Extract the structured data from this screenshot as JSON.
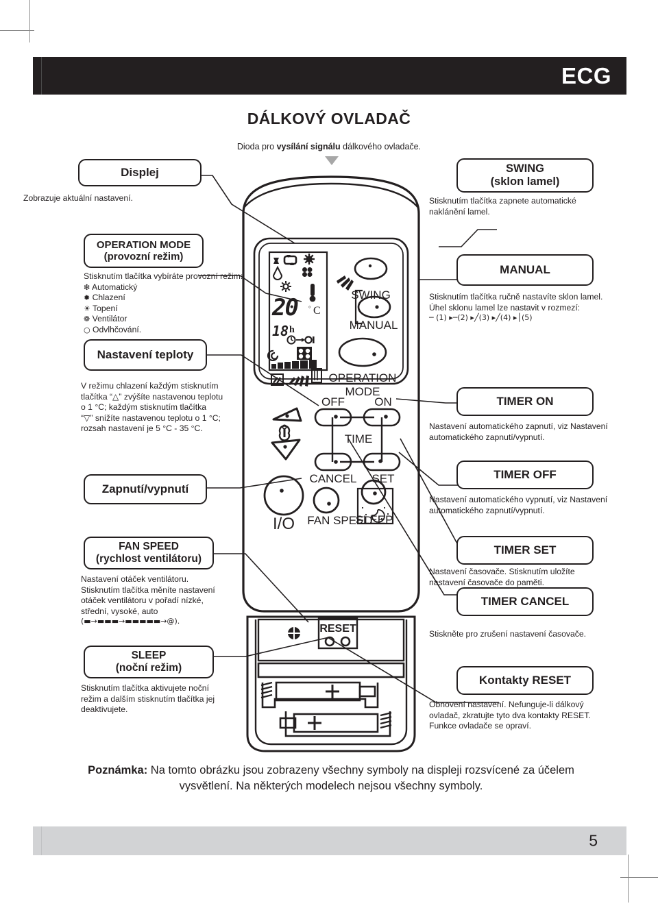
{
  "header": {
    "brand": "ECG"
  },
  "document": {
    "title": "DÁLKOVÝ OVLADAČ",
    "led_caption_pre": "Dioda pro ",
    "led_caption_bold": "vysílání signálu",
    "led_caption_post": " dálkového ovladače."
  },
  "callouts": {
    "display": {
      "title": "Displej",
      "desc": "Zobrazuje aktuální nastavení."
    },
    "operation_mode": {
      "title_line1": "OPERATION MODE",
      "title_line2": "(provozní režim)",
      "desc_intro": "Stisknutím tlačítka vybíráte provozní režim:",
      "modes": [
        {
          "icon": "auto-mode-icon",
          "glyph": "❇",
          "label": "Automatický"
        },
        {
          "icon": "cooling-icon",
          "glyph": "✹",
          "label": "Chlazení"
        },
        {
          "icon": "heating-icon",
          "glyph": "☀",
          "label": "Topení"
        },
        {
          "icon": "fan-icon",
          "glyph": "❁",
          "label": "Ventilátor"
        },
        {
          "icon": "dehumidify-icon",
          "glyph": "○",
          "label": "Odvlhčování."
        }
      ]
    },
    "temperature": {
      "title": "Nastavení teploty",
      "desc_lines": [
        "V režimu chlazení každým stisknutím",
        "tlačítka “△” zvýšíte nastavenou teplotu",
        "o 1 °C; každým stisknutím tlačítka",
        "“▽” snížíte nastavenou teplotu o 1 °C;",
        "rozsah nastavení je 5 °C - 35 °C."
      ]
    },
    "power": {
      "title": "Zapnutí/vypnutí"
    },
    "fan_speed": {
      "title_line1": "FAN SPEED",
      "title_line2": "(rychlost ventilátoru)",
      "desc_lines": [
        "Nastavení otáček ventilátoru.",
        "Stisknutím tlačítka měníte nastavení",
        "otáček ventilátoru v pořadí nízké,",
        "střední, vysoké, auto"
      ],
      "desc_symbols": "(▬→▬▬▬→▬▬▬▬▬→@)."
    },
    "sleep": {
      "title_line1": "SLEEP",
      "title_line2": "(noční režim)",
      "desc_lines": [
        "Stisknutím tlačítka aktivujete noční",
        "režim a dalším stisknutím tlačítka jej",
        "deaktivujete."
      ]
    },
    "swing": {
      "title_line1": "SWING",
      "title_line2": "(sklon lamel)",
      "desc_lines": [
        "Stisknutím tlačítka zapnete automatické",
        "naklánění lamel."
      ]
    },
    "manual": {
      "title": "MANUAL",
      "desc_lines": [
        "Stisknutím tlačítka ručně nastavíte sklon lamel.",
        "Úhel sklonu lamel lze nastavit v rozmezí:"
      ],
      "angle_line": "─ (1)   ▸─(2)   ▸╱(3)   ▸╱(4)   ▸│(5)"
    },
    "timer_on": {
      "title": "TIMER ON",
      "desc_lines": [
        "Nastavení automatického zapnutí, viz Nastavení",
        "automatického zapnutí/vypnutí."
      ]
    },
    "timer_off": {
      "title": "TIMER OFF",
      "desc_lines": [
        "Nastavení automatického vypnutí, viz Nastavení",
        "automatického zapnutí/vypnutí."
      ]
    },
    "timer_set": {
      "title": "TIMER SET",
      "desc_lines": [
        "Nastavení časovače. Stisknutím uložíte",
        "nastavení časovače do paměti."
      ]
    },
    "timer_cancel": {
      "title": "TIMER CANCEL",
      "desc_lines": [
        "Stiskněte pro zrušení nastavení časovače."
      ]
    },
    "reset": {
      "title": "Kontakty RESET",
      "desc_lines": [
        "Obnovení nastavení. Nefunguje-li dálkový",
        "ovladač, zkratujte tyto dva kontakty RESET.",
        "Funkce ovladače se opraví."
      ]
    }
  },
  "remote": {
    "lcd": {
      "temperature": "20",
      "degree": "°",
      "unit": "C",
      "hours": "18",
      "hour_unit": "h"
    },
    "buttons": {
      "swing": "SWING",
      "manual": "MANUAL",
      "operation_mode_line1": "OPERATION",
      "operation_mode_line2": "MODE",
      "timer_off": "OFF",
      "timer_on": "ON",
      "time": "TIME",
      "timer_cancel": "CANCEL",
      "timer_set": "SET",
      "power": "I/O",
      "fan_speed": "FAN SPEED",
      "sleep": "SLEEP",
      "reset": "RESET",
      "battery_plus": "+"
    }
  },
  "note": {
    "label": "Poznámka:",
    "text": " Na tomto obrázku jsou zobrazeny všechny symboly na displeji rozsvícené za účelem vysvětlení. Na některých modelech nejsou všechny symboly."
  },
  "footer": {
    "page_number": "5"
  },
  "colors": {
    "header_bg": "#231f20",
    "footer_bg": "#d2d3d5",
    "ink": "#231f20",
    "paper": "#ffffff"
  }
}
